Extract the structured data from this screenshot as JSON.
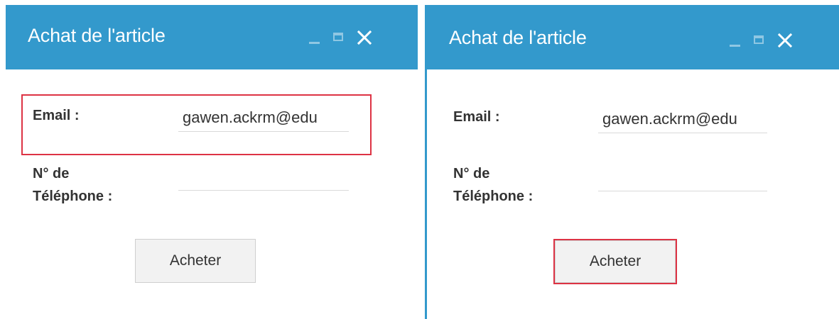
{
  "dialogs": [
    {
      "title": "Achat de l'article",
      "email_label": "Email :",
      "email_value": "gawen.ackrm@edu",
      "phone_label_line1": "N° de",
      "phone_label_line2": "Téléphone :",
      "phone_value": "",
      "buy_label": "Acheter"
    },
    {
      "title": "Achat de l'article",
      "email_label": "Email :",
      "email_value": "gawen.ackrm@edu",
      "phone_label_line1": "N° de",
      "phone_label_line2": "Téléphone :",
      "phone_value": "",
      "buy_label": "Acheter"
    }
  ],
  "colors": {
    "titlebar": "#3399cc",
    "highlight": "#dd3344"
  },
  "icons": [
    "minimize-icon",
    "maximize-icon",
    "close-icon"
  ]
}
